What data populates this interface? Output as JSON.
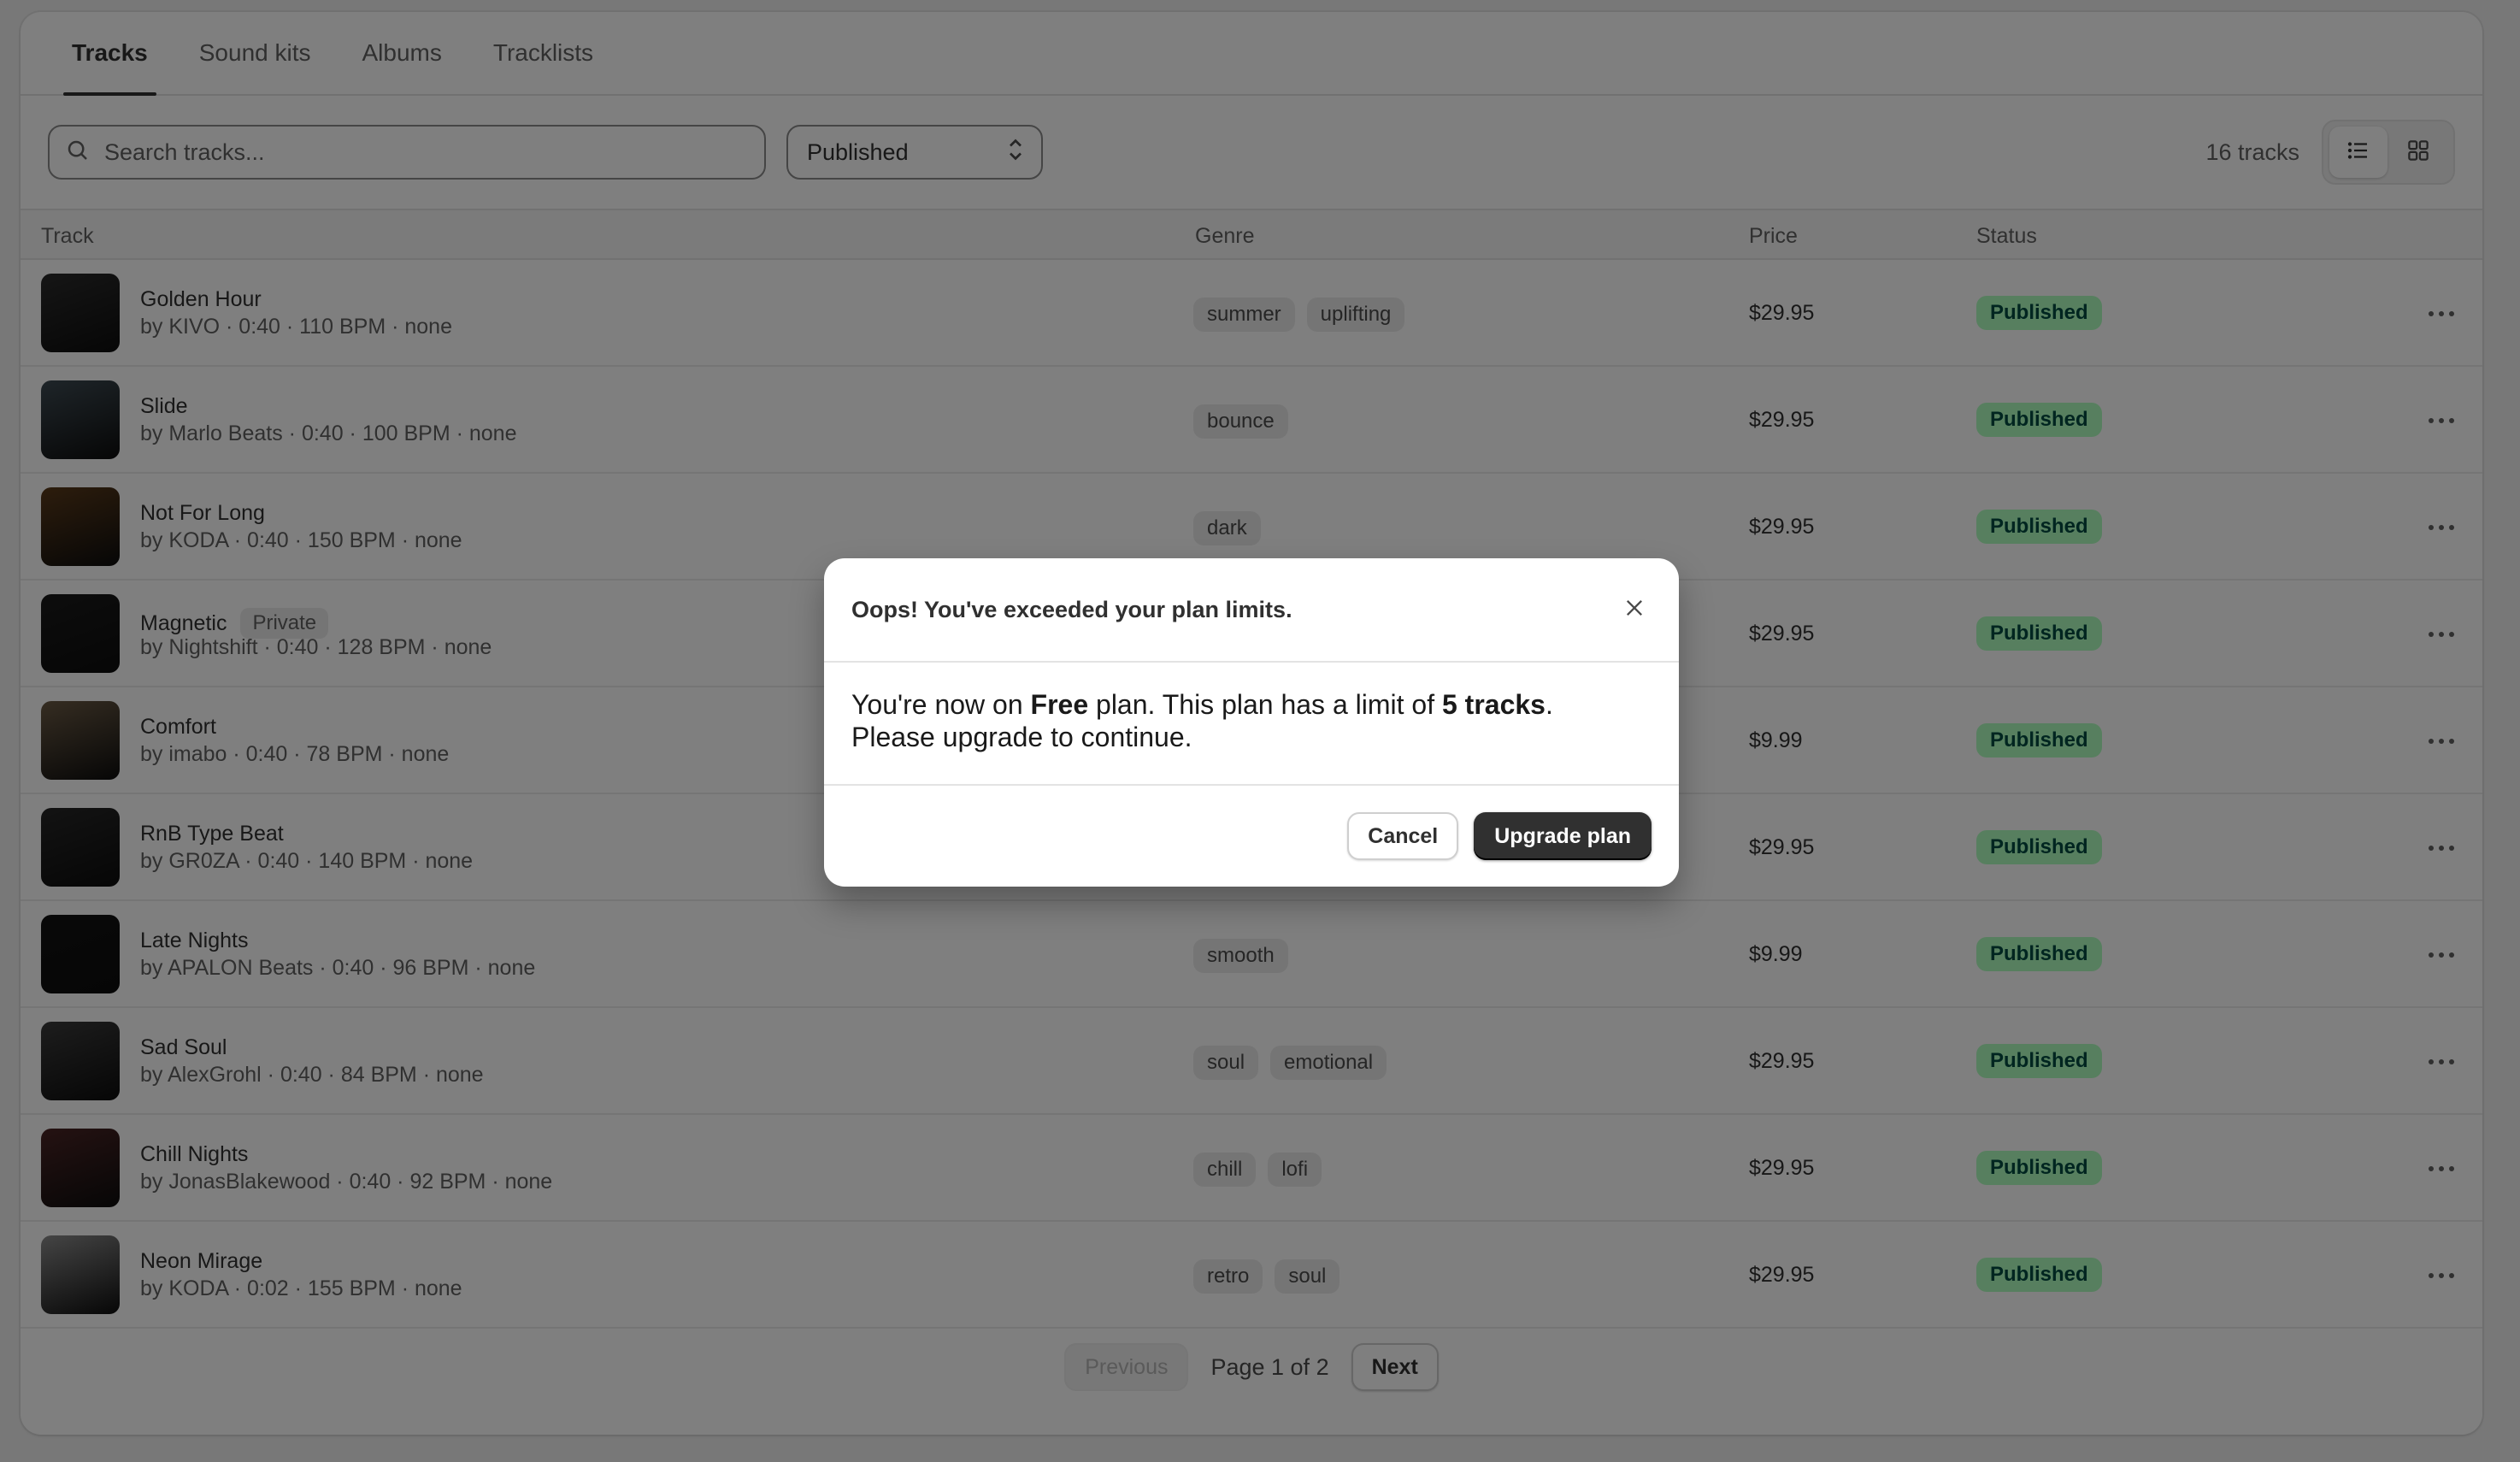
{
  "tabs": [
    {
      "label": "Tracks",
      "active": true
    },
    {
      "label": "Sound kits"
    },
    {
      "label": "Albums"
    },
    {
      "label": "Tracklists"
    }
  ],
  "toolbar": {
    "search_placeholder": "Search tracks...",
    "filter_value": "Published",
    "track_count": "16 tracks",
    "view_mode": "list"
  },
  "table": {
    "columns": [
      "Track",
      "Genre",
      "Price",
      "Status"
    ],
    "rows": [
      {
        "title": "Golden Hour",
        "meta": "by KIVO · 0:40 · 110 BPM · none",
        "genres": [
          "summer",
          "uplifting"
        ],
        "price": "$29.95",
        "status": "Published",
        "thumb_color": "#2b2b2b"
      },
      {
        "title": "Slide",
        "meta": "by Marlo Beats · 0:40 · 100 BPM · none",
        "genres": [
          "bounce"
        ],
        "price": "$29.95",
        "status": "Published",
        "thumb_color": "#3d4a52"
      },
      {
        "title": "Not For Long",
        "meta": "by KODA · 0:40 · 150 BPM · none",
        "genres": [
          "dark"
        ],
        "price": "$29.95",
        "status": "Published",
        "thumb_color": "#5a3a1a"
      },
      {
        "title": "Magnetic",
        "private": "Private",
        "meta": "by Nightshift · 0:40 · 128 BPM · none",
        "genres": [],
        "price": "$29.95",
        "status": "Published",
        "thumb_color": "#1a1a1a"
      },
      {
        "title": "Comfort",
        "meta": "by imabo · 0:40 · 78 BPM · none",
        "genres": [],
        "price": "$9.99",
        "status": "Published",
        "thumb_color": "#6b5a44"
      },
      {
        "title": "RnB Type Beat",
        "meta": "by GR0ZA · 0:40 · 140 BPM · none",
        "genres": [],
        "price": "$29.95",
        "status": "Published",
        "thumb_color": "#262626"
      },
      {
        "title": "Late Nights",
        "meta": "by APALON Beats · 0:40 · 96 BPM · none",
        "genres": [
          "smooth"
        ],
        "price": "$9.99",
        "status": "Published",
        "thumb_color": "#111111"
      },
      {
        "title": "Sad Soul",
        "meta": "by AlexGrohl · 0:40 · 84 BPM · none",
        "genres": [
          "soul",
          "emotional"
        ],
        "price": "$29.95",
        "status": "Published",
        "thumb_color": "#3a3a3a"
      },
      {
        "title": "Chill Nights",
        "meta": "by JonasBlakewood · 0:40 · 92 BPM · none",
        "genres": [
          "chill",
          "lofi"
        ],
        "price": "$29.95",
        "status": "Published",
        "thumb_color": "#4a2424"
      },
      {
        "title": "Neon Mirage",
        "meta": "by KODA · 0:02 · 155 BPM · none",
        "genres": [
          "retro",
          "soul"
        ],
        "price": "$29.95",
        "status": "Published",
        "thumb_color": "#8a8a8a"
      }
    ]
  },
  "pagination": {
    "previous_label": "Previous",
    "page_label": "Page 1 of 2",
    "next_label": "Next"
  },
  "modal": {
    "title": "Oops! You've exceeded your plan limits.",
    "body_part1": "You're now on ",
    "plan_name": "Free",
    "body_part2": " plan. This plan has a limit of ",
    "limit": "5 tracks",
    "body_part3": ".",
    "body_line2": "Please upgrade to continue.",
    "cancel_label": "Cancel",
    "upgrade_label": "Upgrade plan"
  },
  "colors": {
    "status_bg": "#affebf",
    "status_text": "#014b40",
    "primary_button": "#303030",
    "overlay": "rgba(0,0,0,0.5)"
  },
  "icons": {
    "search": "search-icon",
    "select": "chevron-up-down-icon",
    "list_view": "list-icon",
    "grid_view": "grid-icon",
    "row_actions": "more-horizontal-icon",
    "close": "close-icon"
  }
}
